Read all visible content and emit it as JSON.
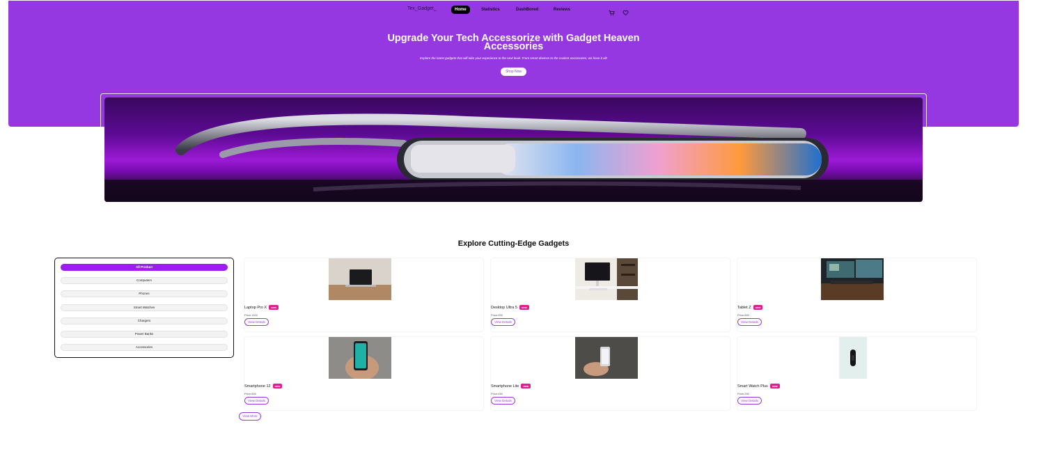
{
  "header": {
    "logo": "Tex_Gadget_",
    "nav": [
      {
        "label": "Home",
        "active": true
      },
      {
        "label": "Statistics",
        "active": false
      },
      {
        "label": "DashBored",
        "active": false
      },
      {
        "label": "Reviews",
        "active": false
      }
    ],
    "icons": [
      "cart-icon",
      "heart-icon"
    ]
  },
  "hero": {
    "title_line1": "Upgrade Your Tech Accessorize with Gadget Heaven",
    "title_line2": "Accessories",
    "subtitle": "Explore the latest gadgets that will take your experience to the next level. From smart devices to the coolest accessories, we have it all!",
    "cta": "Shop Now"
  },
  "colors": {
    "primary": "#9538e2",
    "badge": "#e11d8f",
    "active_category": "#9f1cf0"
  },
  "section": {
    "title": "Explore Cutting-Edge Gadgets"
  },
  "categories": [
    {
      "label": "All Product",
      "active": true
    },
    {
      "label": "Computers",
      "active": false
    },
    {
      "label": "Phones",
      "active": false
    },
    {
      "label": "Smart Watches",
      "active": false
    },
    {
      "label": "Chargers",
      "active": false
    },
    {
      "label": "Power Banks",
      "active": false
    },
    {
      "label": "Accessories",
      "active": false
    }
  ],
  "products": [
    {
      "name": "Laptop Pro X",
      "badge": "new",
      "price": "Price:1100",
      "button": "View Details",
      "image": "laptop-photo"
    },
    {
      "name": "Desktop Ultra 5",
      "badge": "new",
      "price": "Price:900",
      "button": "View Details",
      "image": "desktop-photo"
    },
    {
      "name": "Tablet Z",
      "badge": "new",
      "price": "Price:600",
      "button": "View Details",
      "image": "monitor-desk-photo"
    },
    {
      "name": "Smartphone 12",
      "badge": "new",
      "price": "Price:800",
      "button": "View Details",
      "image": "phone-in-hand-photo"
    },
    {
      "name": "Smartphone Lite",
      "badge": "new",
      "price": "Price:450",
      "button": "View Details",
      "image": "phone-in-hand-photo"
    },
    {
      "name": "Smart Watch Plus",
      "badge": "new",
      "price": "Price:250",
      "button": "View Details",
      "image": "smart-band-photo"
    }
  ],
  "view_more": "View More"
}
